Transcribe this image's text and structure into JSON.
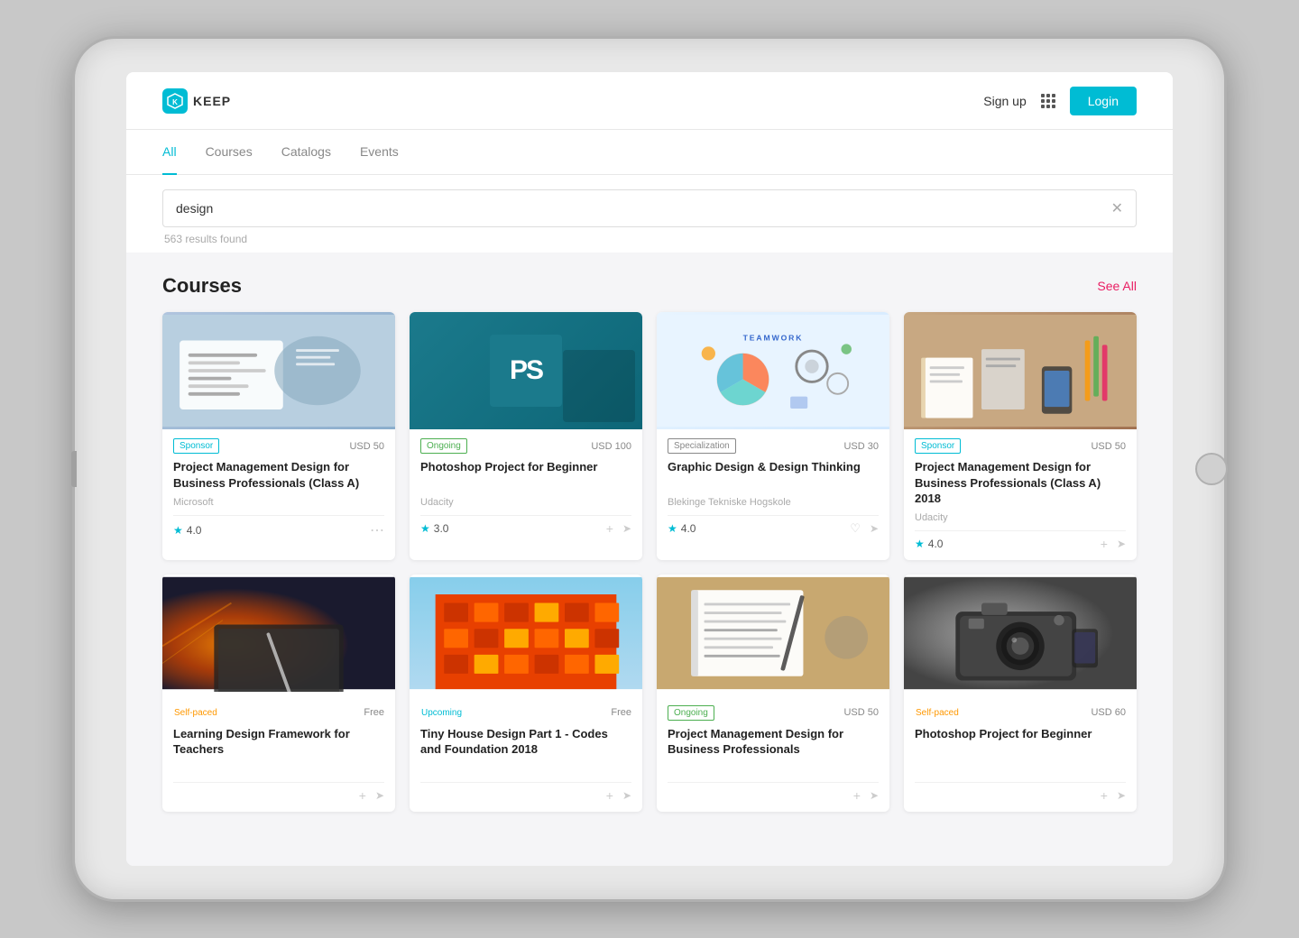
{
  "app": {
    "title": "KEEP",
    "logo_letter": "K"
  },
  "header": {
    "signup_label": "Sign up",
    "login_label": "Login"
  },
  "tabs": [
    {
      "label": "All",
      "active": true
    },
    {
      "label": "Courses",
      "active": false
    },
    {
      "label": "Catalogs",
      "active": false
    },
    {
      "label": "Events",
      "active": false
    }
  ],
  "search": {
    "value": "design",
    "placeholder": "Search...",
    "results_count": "563 results found"
  },
  "courses_section": {
    "title": "Courses",
    "see_all_label": "See All"
  },
  "courses_row1": [
    {
      "badge": "Sponsor",
      "badge_type": "sponsor",
      "price": "USD 50",
      "title": "Project Management Design for Business Professionals (Class A)",
      "provider": "Microsoft",
      "rating": "4.0",
      "thumb_type": "pm1"
    },
    {
      "badge": "Ongoing",
      "badge_type": "ongoing",
      "price": "USD 100",
      "title": "Photoshop Project for Beginner",
      "provider": "Udacity",
      "rating": "3.0",
      "thumb_type": "ps"
    },
    {
      "badge": "Specialization",
      "badge_type": "specialization",
      "price": "USD 30",
      "title": "Graphic Design & Design Thinking",
      "provider": "Blekinge Tekniske Hogskole",
      "rating": "4.0",
      "thumb_type": "gd"
    },
    {
      "badge": "Sponsor",
      "badge_type": "sponsor",
      "price": "USD 50",
      "title": "Project Management Design for Business Professionals (Class A) 2018",
      "provider": "Udacity",
      "rating": "4.0",
      "thumb_type": "pm2"
    }
  ],
  "courses_row2": [
    {
      "badge": "Self-paced",
      "badge_type": "self-paced",
      "price": "Free",
      "title": "Learning Design Framework for Teachers",
      "provider": "",
      "rating": "",
      "thumb_type": "ldf"
    },
    {
      "badge": "Upcoming",
      "badge_type": "upcoming",
      "price": "Free",
      "title": "Tiny House Design Part 1 - Codes and Foundation 2018",
      "provider": "",
      "rating": "",
      "thumb_type": "thd"
    },
    {
      "badge": "Ongoing",
      "badge_type": "ongoing",
      "price": "USD 50",
      "title": "Project Management Design for Business Professionals",
      "provider": "",
      "rating": "",
      "thumb_type": "pm3"
    },
    {
      "badge": "Self-paced",
      "badge_type": "self-paced",
      "price": "USD 60",
      "title": "Photoshop Project for Beginner",
      "provider": "",
      "rating": "",
      "thumb_type": "ps2"
    }
  ]
}
